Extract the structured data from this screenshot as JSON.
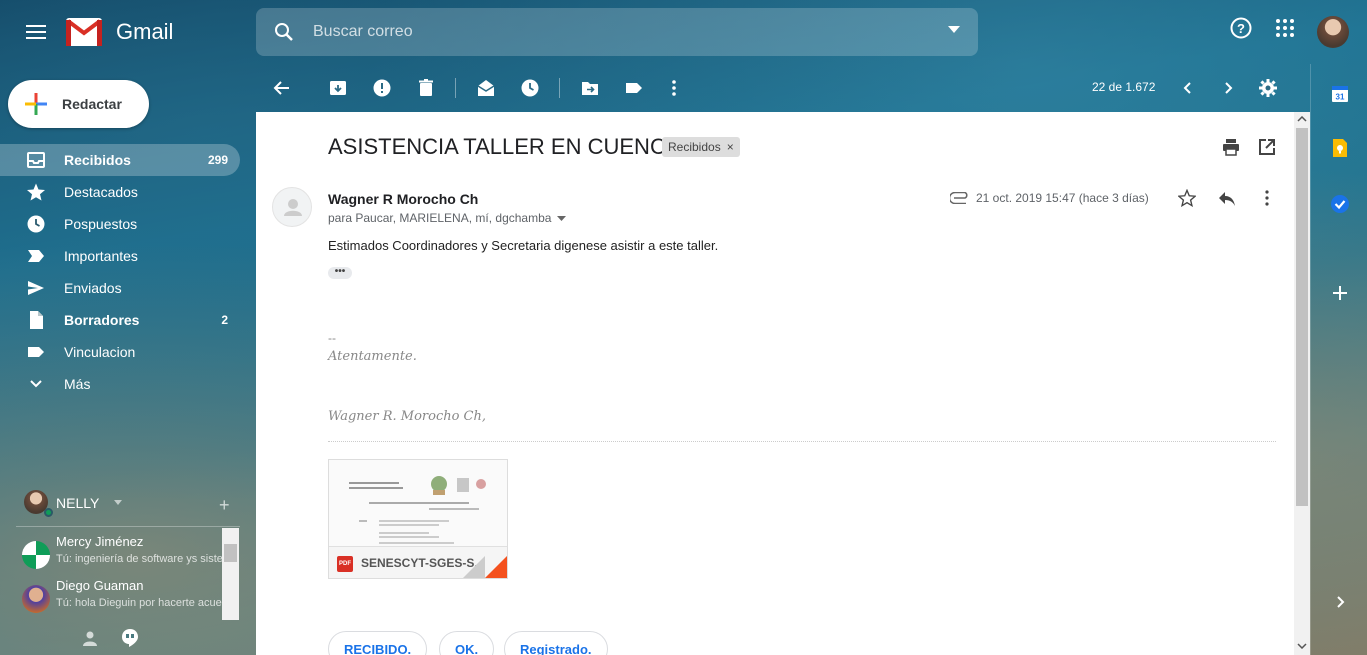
{
  "app": {
    "name": "Gmail",
    "search_placeholder": "Buscar correo"
  },
  "compose": {
    "label": "Redactar"
  },
  "nav": [
    {
      "label": "Recibidos",
      "count": "299",
      "icon": "inbox-icon",
      "active": true,
      "bold": true
    },
    {
      "label": "Destacados",
      "count": "",
      "icon": "star-icon"
    },
    {
      "label": "Pospuestos",
      "count": "",
      "icon": "clock-icon"
    },
    {
      "label": "Importantes",
      "count": "",
      "icon": "important-icon"
    },
    {
      "label": "Enviados",
      "count": "",
      "icon": "send-icon"
    },
    {
      "label": "Borradores",
      "count": "2",
      "icon": "draft-icon",
      "bold": true
    },
    {
      "label": "Vinculacion",
      "count": "",
      "icon": "label-icon"
    },
    {
      "label": "Más",
      "count": "",
      "icon": "chevron-down-icon"
    }
  ],
  "hangouts": {
    "user": "NELLY",
    "contacts": [
      {
        "name": "Mercy Jiménez",
        "message": "Tú: ingeniería de software ys sistemas"
      },
      {
        "name": "Diego Guaman",
        "message": "Tú: hola Dieguin por hacerte acuerdo"
      }
    ]
  },
  "toolbar": {
    "count": "22 de 1.672"
  },
  "message": {
    "subject": "ASISTENCIA TALLER EN CUENCA",
    "label": "Recibidos",
    "sender": "Wagner R Morocho Ch",
    "recipients": "para Paucar, MARIELENA, mí, dgchamba",
    "date": "21 oct. 2019 15:47 (hace 3 días)",
    "body": "Estimados Coordinadores y Secretaria digenese asistir a este taller.",
    "ellipsis": "•••",
    "signature_dash": "--",
    "signature_line1": "Atentamente.",
    "signature_line2": "Wagner R. Morocho Ch,",
    "attachment": {
      "name": "SENESCYT-SGES-S...",
      "type": "PDF"
    }
  },
  "smart_replies": [
    "RECIBIDO.",
    "OK.",
    "Registrado."
  ],
  "colors": {
    "accent_blue": "#1a73e8",
    "gmail_red": "#d93025",
    "pdf_red": "#d93025"
  }
}
